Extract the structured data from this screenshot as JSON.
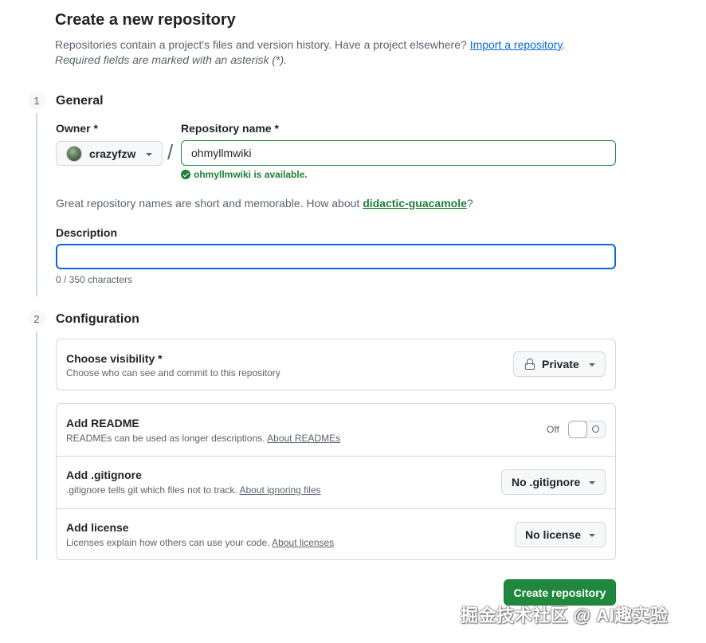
{
  "header": {
    "title": "Create a new repository",
    "intro_text": "Repositories contain a project's files and version history. Have a project elsewhere?",
    "import_link": "Import a repository",
    "intro_period": ".",
    "required_note": "Required fields are marked with an asterisk (*)."
  },
  "steps": {
    "general": {
      "number": "1",
      "title": "General"
    },
    "configuration": {
      "number": "2",
      "title": "Configuration"
    }
  },
  "owner": {
    "label": "Owner *",
    "value": "crazyfzw"
  },
  "separator": "/",
  "repository_name": {
    "label": "Repository name *",
    "value": "ohmyllmwiki",
    "availability": "ohmyllmwiki is available."
  },
  "suggestion": {
    "text": "Great repository names are short and memorable. How about",
    "name": "didactic-guacamole",
    "suffix": "?"
  },
  "description": {
    "label": "Description",
    "value": "",
    "char_count": "0 / 350 characters"
  },
  "visibility": {
    "title": "Choose visibility *",
    "desc": "Choose who can see and commit to this repository",
    "selected": "Private"
  },
  "readme": {
    "title": "Add README",
    "desc": "READMEs can be used as longer descriptions.",
    "link": "About READMEs",
    "state_label": "Off"
  },
  "gitignore": {
    "title": "Add .gitignore",
    "desc": ".gitignore tells git which files not to track.",
    "link": "About ignoring files",
    "selected": "No .gitignore"
  },
  "license": {
    "title": "Add license",
    "desc": "Licenses explain how others can use your code.",
    "link": "About licenses",
    "selected": "No license"
  },
  "actions": {
    "create_label": "Create repository"
  },
  "watermark": "掘金技术社区 @ AI趣实验",
  "colors": {
    "accent_green": "#1f883d",
    "link_blue": "#0969da",
    "success_green": "#1a7f37",
    "focus_blue": "#0969da"
  }
}
